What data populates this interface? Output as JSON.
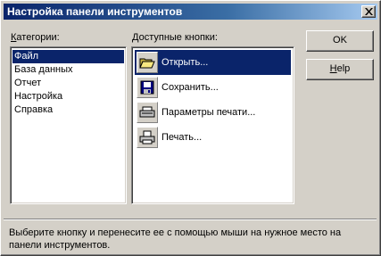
{
  "window": {
    "title": "Настройка панели инструментов"
  },
  "categories": {
    "label_prefix": "К",
    "label_rest": "атегории:",
    "items": [
      {
        "label": "Файл",
        "selected": true
      },
      {
        "label": "База данных",
        "selected": false
      },
      {
        "label": "Отчет",
        "selected": false
      },
      {
        "label": "Настройка",
        "selected": false
      },
      {
        "label": "Справка",
        "selected": false
      }
    ]
  },
  "buttons": {
    "label_prefix": "Д",
    "label_rest": "оступные кнопки:",
    "items": [
      {
        "label": "Открыть...",
        "icon": "open-folder-icon",
        "selected": true
      },
      {
        "label": "Сохранить...",
        "icon": "save-floppy-icon",
        "selected": false
      },
      {
        "label": "Параметры печати...",
        "icon": "print-setup-icon",
        "selected": false
      },
      {
        "label": "Печать...",
        "icon": "printer-icon",
        "selected": false
      }
    ]
  },
  "actions": {
    "ok_label": "OK",
    "help_prefix": "H",
    "help_rest": "elp"
  },
  "description": "Выберите кнопку и перенесите ее с помощью мыши на нужное место на панели инструментов."
}
